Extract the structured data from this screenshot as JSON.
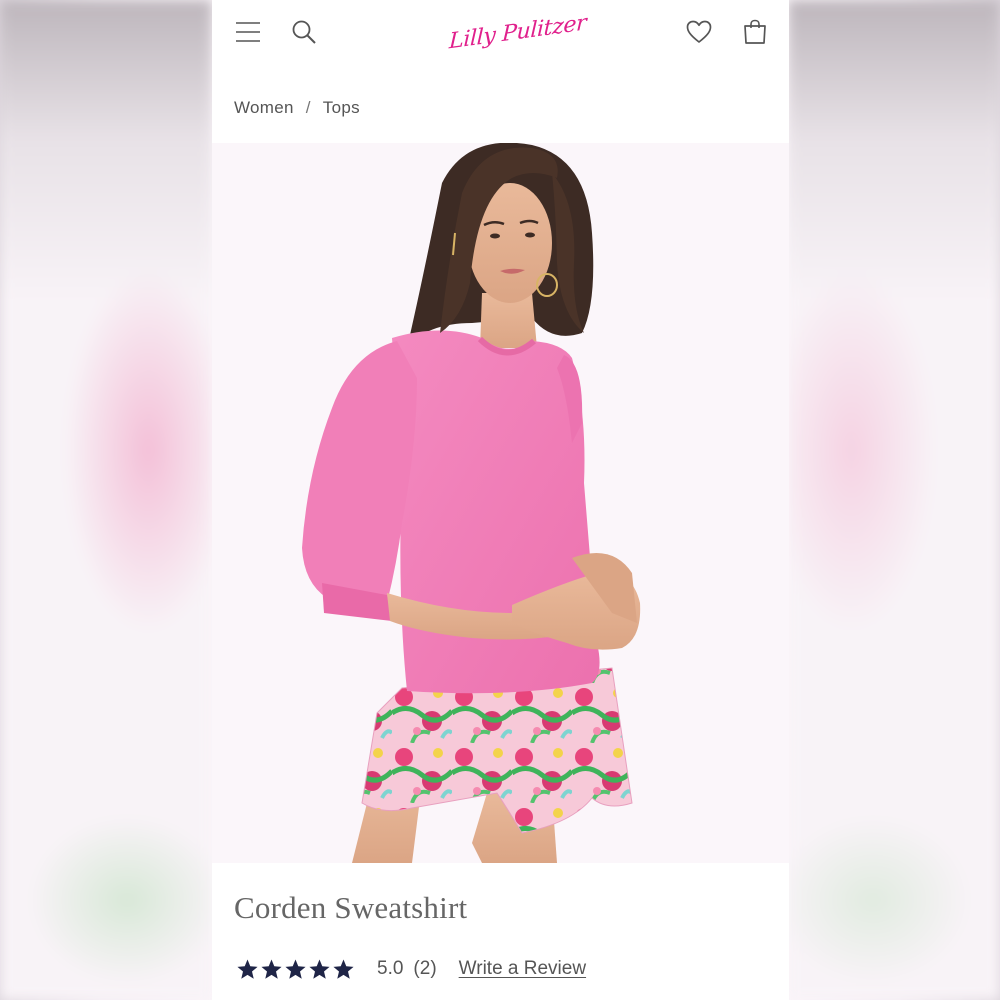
{
  "header": {
    "logo_text": "Lilly Pulitzer",
    "icons": [
      "menu-icon",
      "search-icon",
      "heart-icon",
      "shopping-bag-icon"
    ]
  },
  "breadcrumb": {
    "items": [
      "Women",
      "Tops"
    ],
    "separator": "/"
  },
  "product": {
    "title": "Corden Sweatshirt",
    "rating_value": "5.0",
    "rating_count": "(2)",
    "stars": 5,
    "review_link": "Write a Review"
  },
  "colors": {
    "brand_pink": "#e0208c",
    "star_navy": "#1f2547",
    "sweatshirt_pink": "#f27fb8",
    "text_gray": "#555555"
  }
}
